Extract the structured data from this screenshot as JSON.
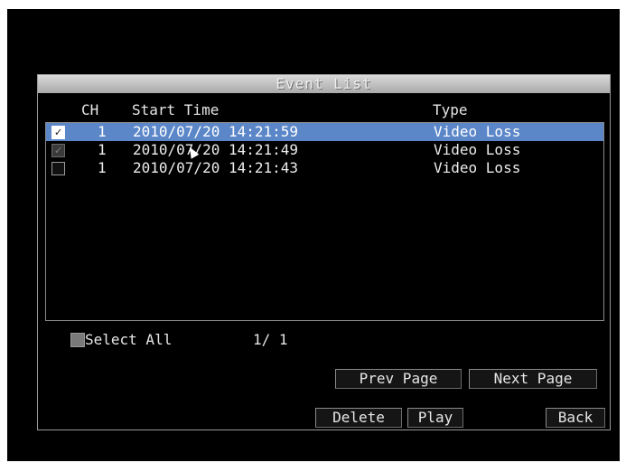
{
  "dialog": {
    "title": "Event List"
  },
  "columns": {
    "ch": "CH",
    "start_time": "Start Time",
    "type": "Type"
  },
  "rows": [
    {
      "checked": true,
      "ch": "1",
      "start_time": "2010/07/20 14:21:59",
      "type": "Video Loss",
      "selected": true
    },
    {
      "checked": true,
      "ch": "1",
      "start_time": "2010/07/20 14:21:49",
      "type": "Video Loss",
      "selected": false
    },
    {
      "checked": false,
      "ch": "1",
      "start_time": "2010/07/20 14:21:43",
      "type": "Video Loss",
      "selected": false
    }
  ],
  "footer": {
    "select_all_label": "Select All",
    "page_indicator": "1/ 1"
  },
  "buttons": {
    "prev_page": "Prev Page",
    "next_page": "Next Page",
    "delete": "Delete",
    "play": "Play",
    "back": "Back"
  },
  "colors": {
    "highlight": "#5b86c8",
    "background": "#000000",
    "text": "#e6e6e6"
  }
}
